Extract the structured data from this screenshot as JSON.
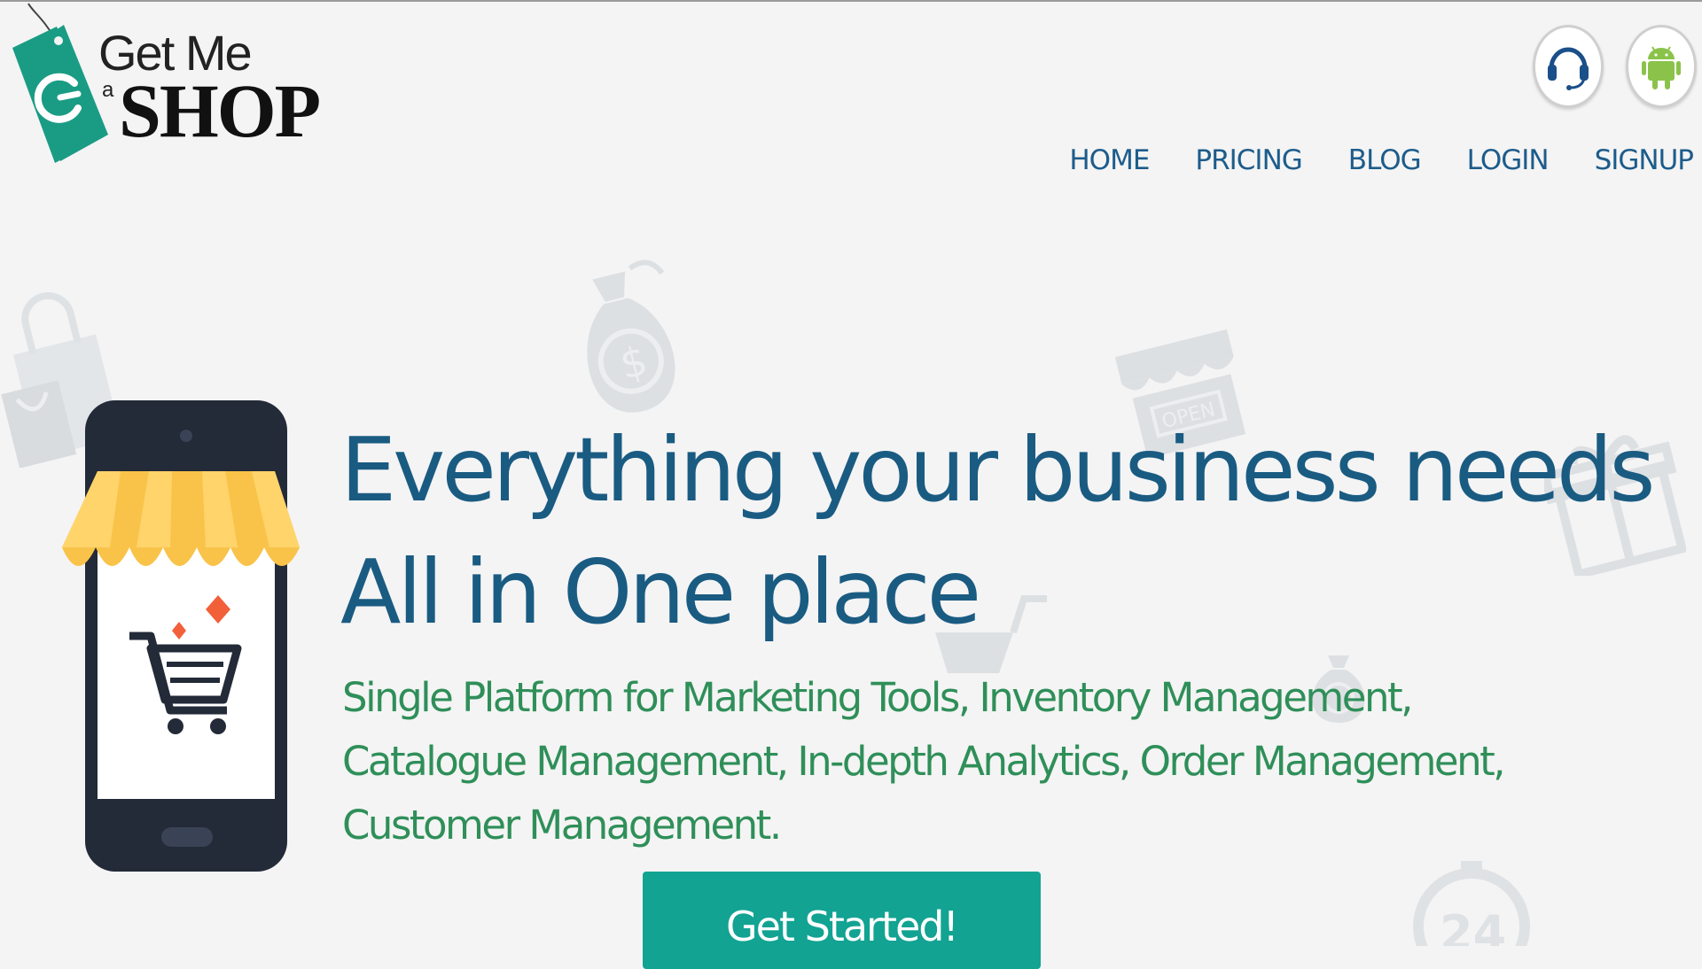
{
  "brand": {
    "line1": "Get Me",
    "line2": "a",
    "line3": "SHOP"
  },
  "header": {
    "support_icon": "headset-icon",
    "android_icon": "android-icon"
  },
  "nav": {
    "items": [
      {
        "label": "HOME"
      },
      {
        "label": "PRICING"
      },
      {
        "label": "BLOG"
      },
      {
        "label": "LOGIN"
      },
      {
        "label": "SIGNUP"
      }
    ]
  },
  "hero": {
    "title_line1": "Everything your business needs",
    "title_line2": "All in One place",
    "subtitle": "Single Platform for Marketing Tools, Inventory Management, Catalogue Management, In-depth Analytics, Order Management, Customer Management.",
    "cta_label": "Get Started!"
  },
  "decorations": {
    "open_sign": "OPEN",
    "clock_number": "24"
  },
  "colors": {
    "accent": "#12a392",
    "title": "#1a5b82",
    "subtitle": "#2f8f59",
    "nav": "#1d5c8b",
    "logo_tag": "#1a9c84"
  }
}
